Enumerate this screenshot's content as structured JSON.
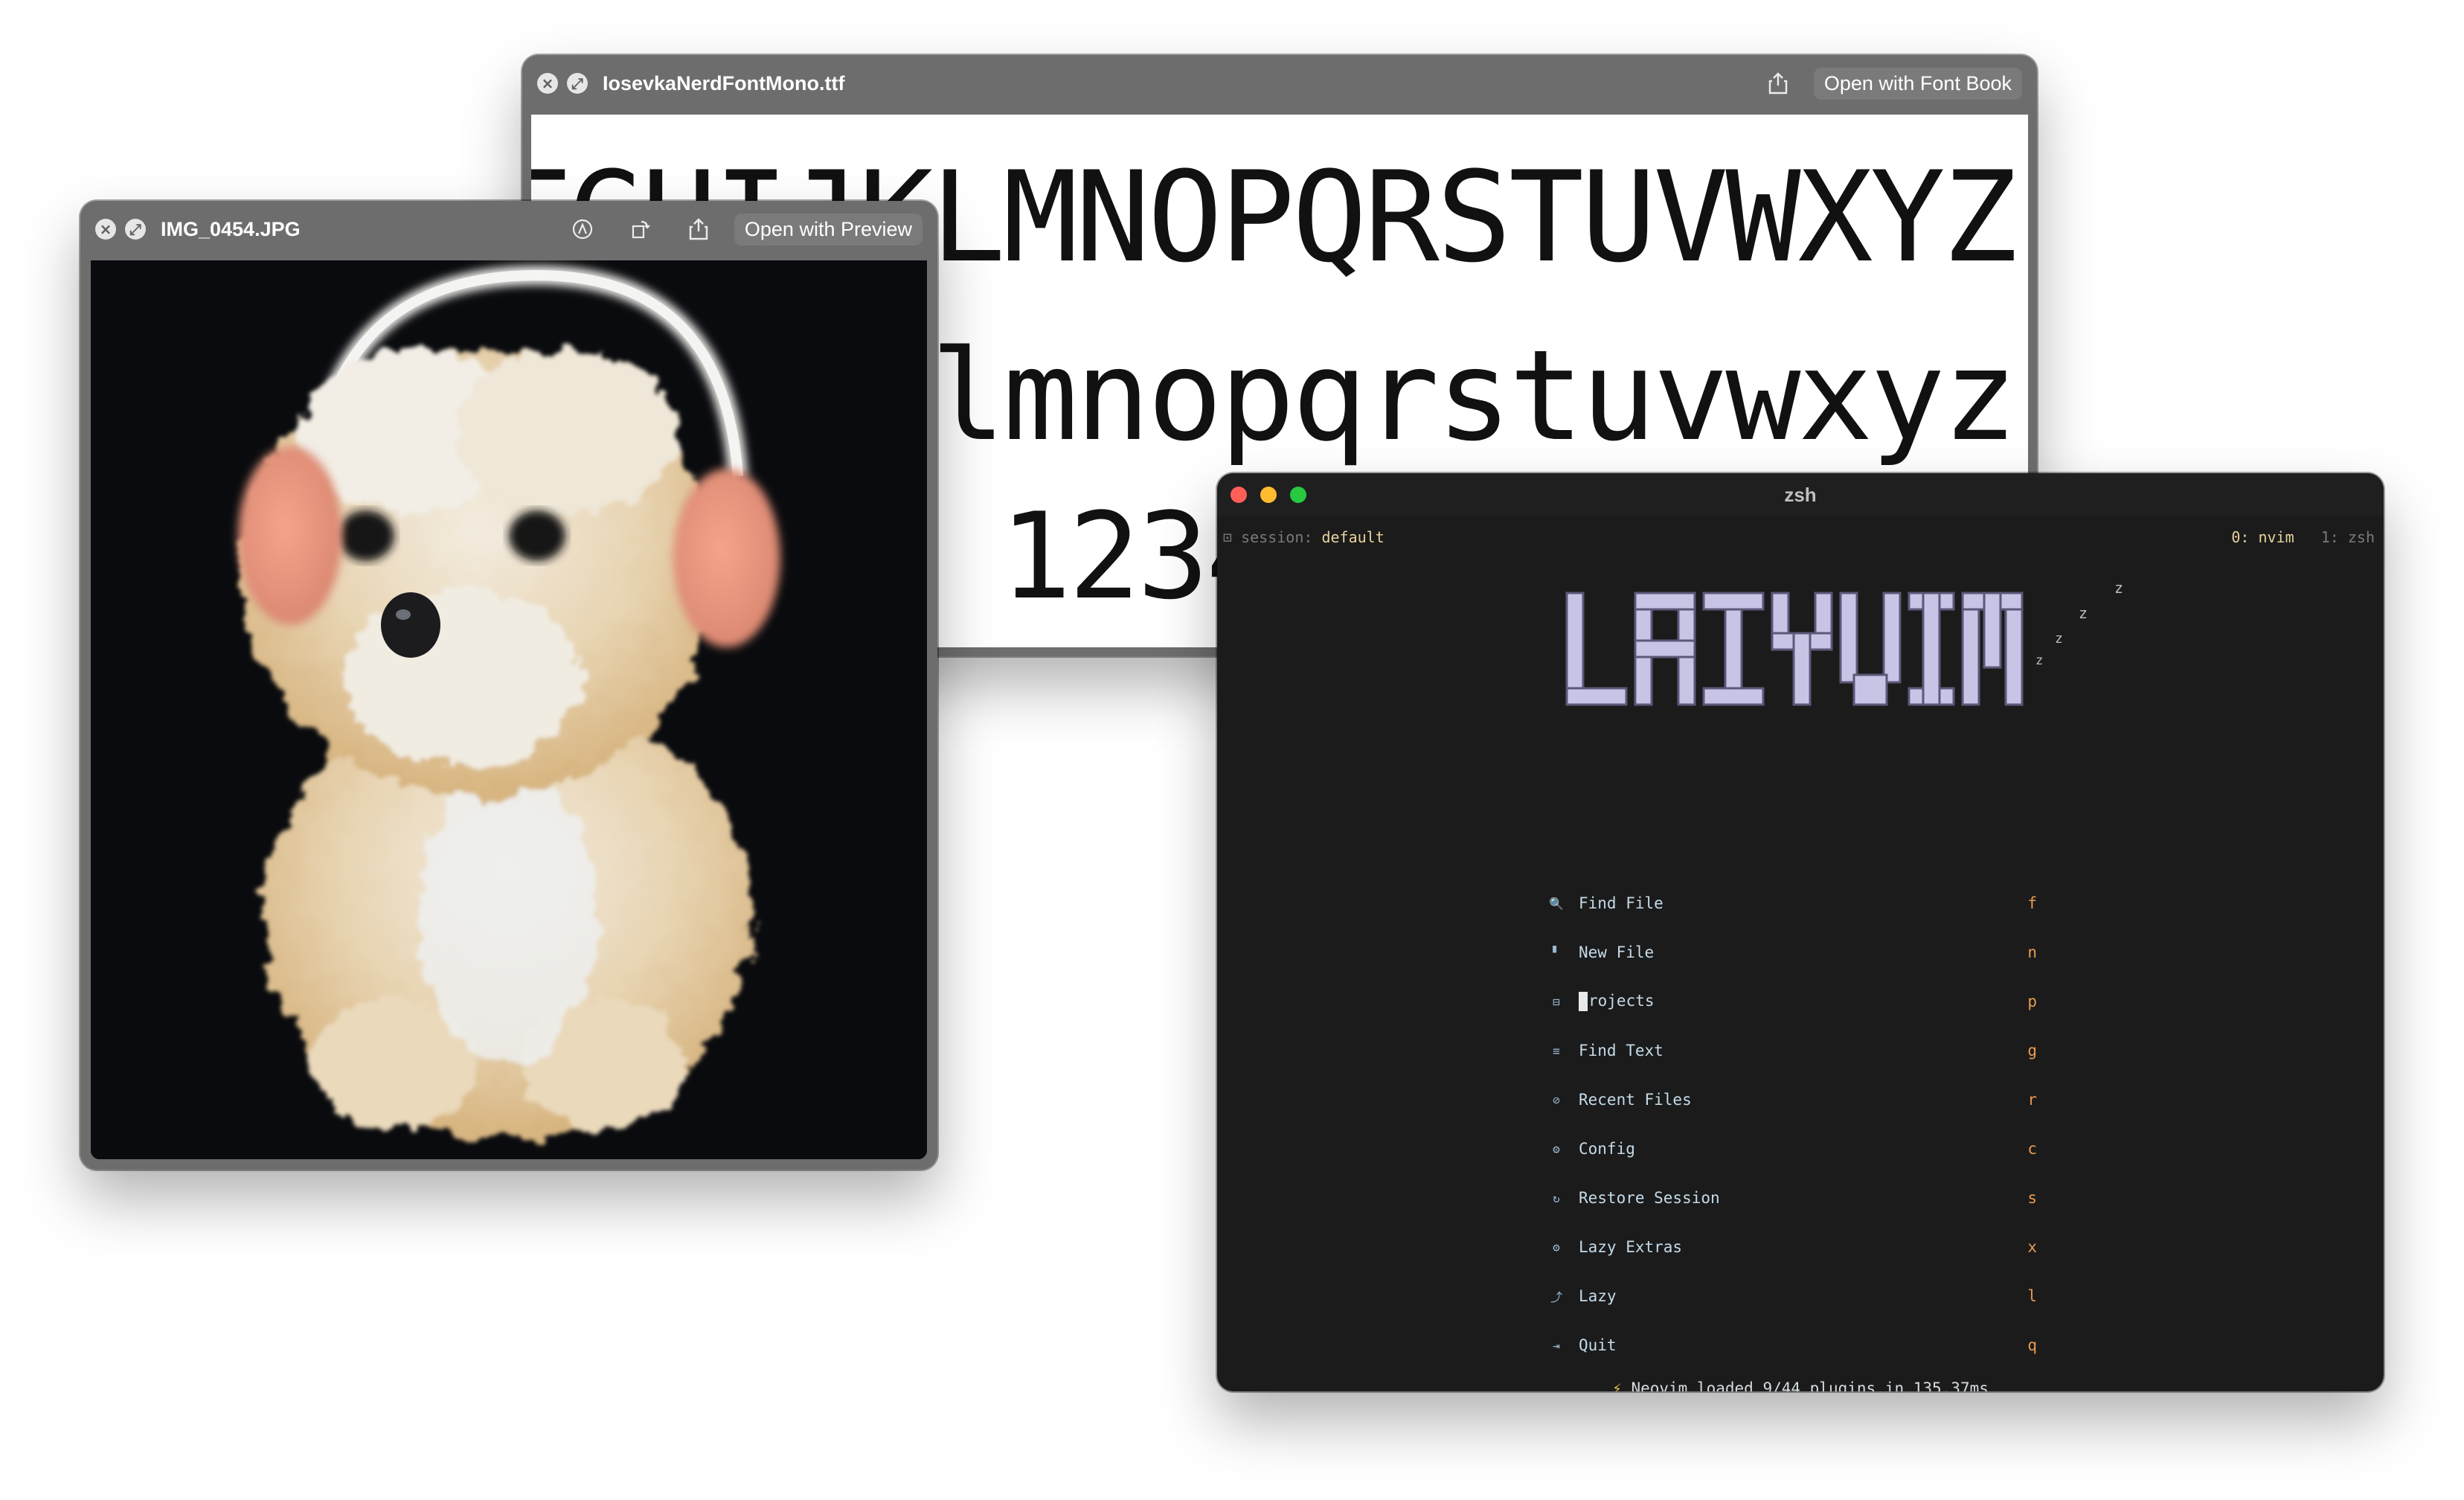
{
  "font_window": {
    "title": "IosevkaNerdFontMono.ttf",
    "open_button": "Open with Font Book",
    "preview": {
      "uppercase": "ABCDEFGHIJKLMNOPQRSTUVWXYZ",
      "lowercase": "abcdefghijklmnopqrstuvwxyz",
      "digits": "1234"
    }
  },
  "image_window": {
    "title": "IMG_0454.JPG",
    "open_button": "Open with Preview",
    "image_subject": "fluffy puppy wearing headphones"
  },
  "terminal": {
    "title": "zsh",
    "session_label": "session:",
    "session_value": "default",
    "tab_active": "0: nvim",
    "tab_other": "1: zsh",
    "logo_text": "LAZYVIM",
    "menu": [
      {
        "icon": "search-icon",
        "glyph": "🔍",
        "label": "Find File",
        "key": "f"
      },
      {
        "icon": "file-icon",
        "glyph": "▘",
        "label": "New File",
        "key": "n"
      },
      {
        "icon": "folder-icon",
        "glyph": "⊟",
        "label": "Projects",
        "key": "p"
      },
      {
        "icon": "text-search-icon",
        "glyph": "≡",
        "label": "Find Text",
        "key": "g"
      },
      {
        "icon": "history-icon",
        "glyph": "⊘",
        "label": "Recent Files",
        "key": "r"
      },
      {
        "icon": "gear-icon",
        "glyph": "⚙",
        "label": "Config",
        "key": "c"
      },
      {
        "icon": "restore-icon",
        "glyph": "↻",
        "label": "Restore Session",
        "key": "s"
      },
      {
        "icon": "extras-icon",
        "glyph": "⚙",
        "label": "Lazy Extras",
        "key": "x"
      },
      {
        "icon": "lazy-icon",
        "glyph": "⤴",
        "label": "Lazy",
        "key": "l"
      },
      {
        "icon": "quit-icon",
        "glyph": "⇥",
        "label": "Quit",
        "key": "q"
      }
    ],
    "footer": "Neovim loaded 9/44 plugins in 135.37ms",
    "footer_icon": "⚡"
  },
  "colors": {
    "quicklook_bar": "#6d6d6d",
    "terminal_bg": "#1b1b1c",
    "menu_text": "#c5dbe8",
    "menu_key": "#e99b4e",
    "session_value": "#e7d39a",
    "logo_fill": "#c7c4e6",
    "traffic_red": "#ff5f57",
    "traffic_yellow": "#febc2e",
    "traffic_green": "#28c840"
  }
}
